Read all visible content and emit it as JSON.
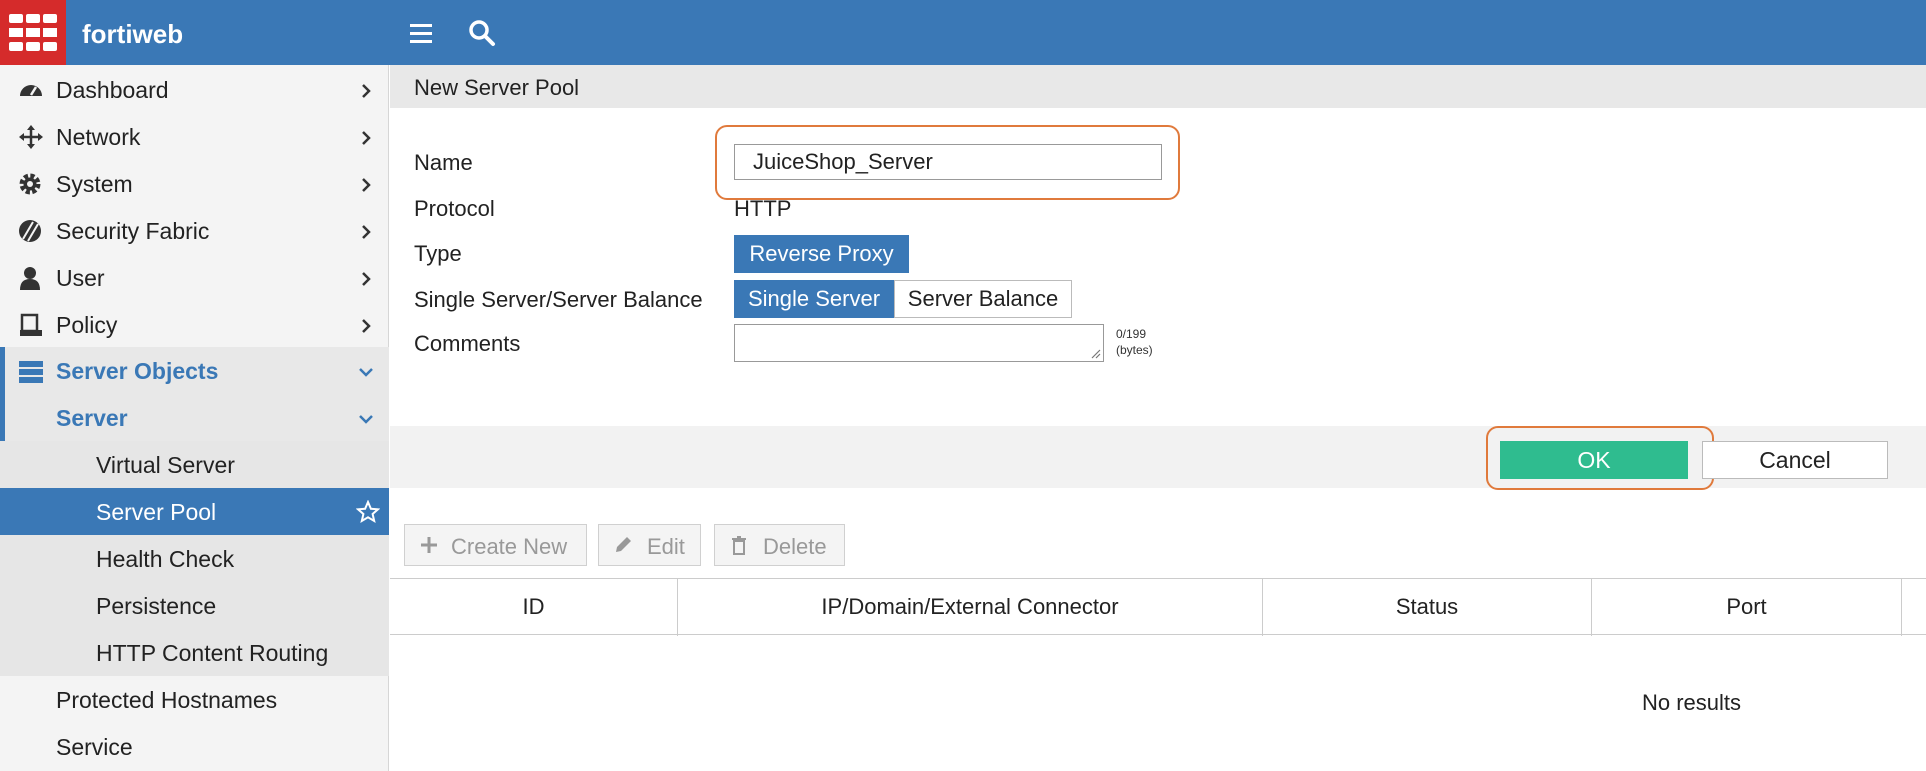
{
  "app": {
    "brand": "fortiweb",
    "menu_icon": "hamburger-menu-icon",
    "search_icon": "search-icon"
  },
  "sidebar": {
    "items": [
      {
        "label": "Dashboard",
        "icon": "dashboard-icon"
      },
      {
        "label": "Network",
        "icon": "network-icon"
      },
      {
        "label": "System",
        "icon": "gear-icon"
      },
      {
        "label": "Security Fabric",
        "icon": "security-fabric-icon"
      },
      {
        "label": "User",
        "icon": "user-icon"
      },
      {
        "label": "Policy",
        "icon": "policy-icon"
      },
      {
        "label": "Server Objects",
        "icon": "server-objects-icon"
      }
    ],
    "server": "Server",
    "sub_items": [
      "Virtual Server",
      "Server Pool",
      "Health Check",
      "Persistence",
      "HTTP Content Routing"
    ],
    "after": [
      "Protected Hostnames",
      "Service"
    ]
  },
  "form": {
    "title": "New Server Pool",
    "name_label": "Name",
    "name_value": "JuiceShop_Server",
    "protocol_label": "Protocol",
    "protocol_value": "HTTP",
    "type_label": "Type",
    "type_value": "Reverse Proxy",
    "balance_label": "Single Server/Server Balance",
    "balance_options": [
      "Single Server",
      "Server Balance"
    ],
    "balance_selected": "Single Server",
    "comments_label": "Comments",
    "comments_counter": "0/199",
    "comments_unit": "(bytes)",
    "ok": "OK",
    "cancel": "Cancel"
  },
  "toolbar": {
    "create": "Create New",
    "edit": "Edit",
    "delete": "Delete"
  },
  "table": {
    "columns": [
      "ID",
      "IP/Domain/External Connector",
      "Status",
      "Port"
    ],
    "empty": "No results"
  },
  "colors": {
    "header_blue": "#3a78b6",
    "logo_red": "#d52b2b",
    "ok_green": "#2fbc8f",
    "highlight_orange": "#e07a3c"
  }
}
